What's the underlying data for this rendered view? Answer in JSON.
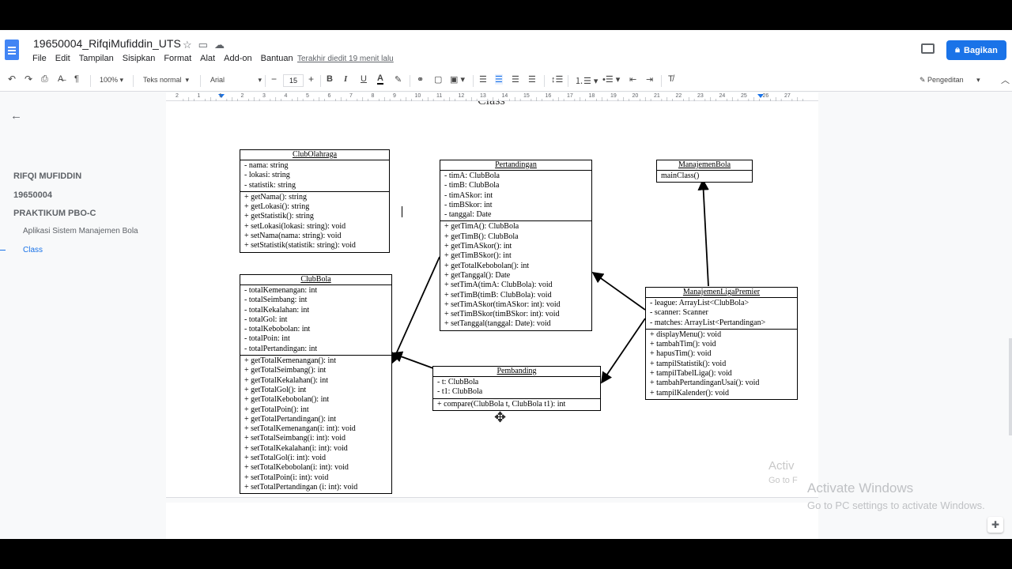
{
  "doc": {
    "title": "19650004_RifqiMufiddin_UTS",
    "menus": [
      "File",
      "Edit",
      "Tampilan",
      "Sisipkan",
      "Format",
      "Alat",
      "Add-on",
      "Bantuan"
    ],
    "last_edit": "Terakhir diedit 19 menit lalu",
    "share_label": "Bagikan"
  },
  "toolbar": {
    "zoom": "100%",
    "style": "Teks normal",
    "font": "Arial",
    "font_size": "15",
    "mode": "Pengeditan",
    "bold": "B",
    "italic": "I",
    "underline": "U",
    "text_color": "A"
  },
  "ruler": {
    "numbers": [
      "2",
      "1",
      "1",
      "2",
      "3",
      "4",
      "5",
      "6",
      "7",
      "8",
      "9",
      "10",
      "11",
      "12",
      "13",
      "14",
      "15",
      "16",
      "17",
      "18",
      "19",
      "20",
      "21",
      "22",
      "23",
      "24",
      "25",
      "26",
      "27"
    ]
  },
  "outline": {
    "items": [
      "RIFQI MUFIDDIN",
      "19650004",
      "PRAKTIKUM PBO-C"
    ],
    "subitems": [
      "Aplikasi Sistem Manajemen Bola",
      "Class"
    ]
  },
  "page": {
    "heading_partial": "Class"
  },
  "diagram": {
    "classes": [
      {
        "id": "clubolahraga",
        "name": "ClubOlahraga",
        "attributes": [
          "- nama: string",
          "- lokasi: string",
          "- statistik: string"
        ],
        "methods": [
          "+ getNama(): string",
          "+ getLokasi(): string",
          "+ getStatistik(): string",
          "+ setLokasi(lokasi: string): void",
          "+ setNama(nama: string): void",
          "+ setStatistik(statistik: string): void"
        ]
      },
      {
        "id": "clubbola",
        "name": "ClubBola",
        "attributes": [
          "- totalKemenangan: int",
          "- totalSeimbang: int",
          "- totalKekalahan: int",
          "- totalGol: int",
          "- totalKebobolan: int",
          "- totalPoin: int",
          "- totalPertandingan: int"
        ],
        "methods": [
          "+ getTotalKemenangan(): int",
          "+ getTotalSeimbang():  int",
          "+ getTotalKekalahan():  int",
          "+ getTotalGol(): int",
          "+ getTotalKebobolan(): int",
          "+ getTotalPoin(): int",
          "+ getTotalPertandingan(): int",
          "+ setTotalKemenangan(i: int): void",
          "+ setTotalSeimbang(i: int): void",
          "+ setTotalKekalahan(i: int): void",
          "+ setTotalGol(i: int): void",
          "+ setTotalKebobolan(i: int): void",
          "+ setTotalPoin(i: int): void",
          "+ setTotalPertandingan (i: int): void"
        ]
      },
      {
        "id": "pertandingan",
        "name": "Pertandingan",
        "attributes": [
          "- timA: ClubBola",
          "- timB: ClubBola",
          "- timASkor: int",
          "- timBSkor: int",
          "- tanggal: Date"
        ],
        "methods": [
          "+ getTimA(): ClubBola",
          "+ getTimB(): ClubBola",
          "+ getTimASkor(): int",
          "+ getTimBSkor(): int",
          "+ getTotalKebobolan(): int",
          "+ getTanggal(): Date",
          "+ setTimA(timA: ClubBola): void",
          "+ setTimB(timB: ClubBola): void",
          "+ setTimASkor(timASkor: int): void",
          "+ setTimBSkor(timBSkor: int): void",
          "+ setTanggal(tanggal: Date): void"
        ]
      },
      {
        "id": "pembanding",
        "name": "Pembanding",
        "attributes": [
          "- t: ClubBola",
          "- t1: ClubBola"
        ],
        "methods": [
          "+ compare(ClubBola t, ClubBola t1): int"
        ]
      },
      {
        "id": "manajemenbola",
        "name": "ManajemenBola",
        "attributes": [],
        "methods": [
          "mainClass()"
        ]
      },
      {
        "id": "manajemenligapremier",
        "name": "ManajemenLigaPremier",
        "attributes": [
          "- league: ArrayList<ClubBola>",
          "- scanner: Scanner",
          "- matches: ArrayList<Pertandingan>"
        ],
        "methods": [
          "+ displayMenu(): void",
          "+ tambahTim(): void",
          "+ hapusTim(): void",
          "+ tampilStatistik(): void",
          "+ tampilTabelLiga(): void",
          "+ tambahPertandinganUsai(): void",
          "+ tampilKalender(): void"
        ]
      }
    ]
  },
  "watermark": {
    "line1": "Activate Windows",
    "line2": "Go to PC settings to activate Windows.",
    "small1": "Activ",
    "small2": "Go to F"
  }
}
